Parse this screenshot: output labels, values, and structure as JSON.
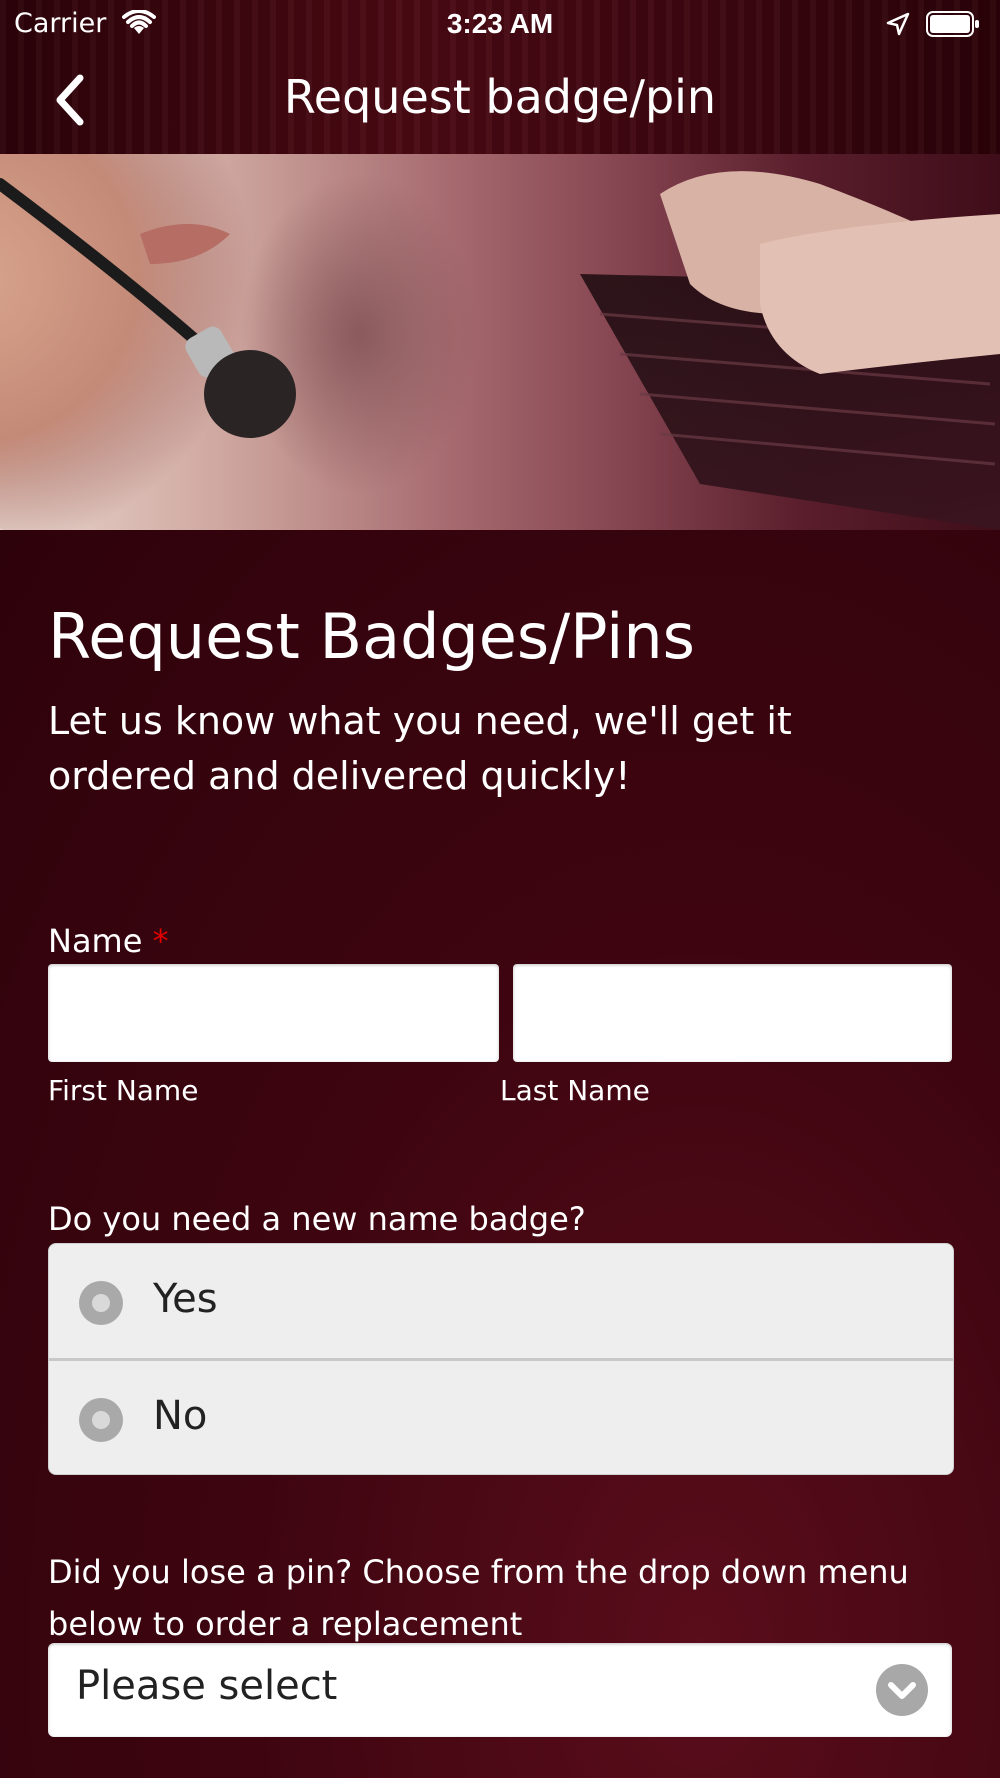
{
  "status_bar": {
    "carrier": "Carrier",
    "time": "3:23 AM",
    "icons": [
      "wifi-icon",
      "location-arrow-icon",
      "battery-icon"
    ]
  },
  "nav": {
    "back_icon": "chevron-left-icon",
    "title": "Request badge/pin"
  },
  "hero": {
    "image": "call-center-headset-and-keyboard-photo"
  },
  "content": {
    "heading": "Request Badges/Pins",
    "intro": "Let us know what you need, we'll get it ordered and delivered quickly!"
  },
  "form": {
    "name": {
      "label": "Name",
      "required_marker": "*",
      "first_name": {
        "value": "",
        "sublabel": "First Name"
      },
      "last_name": {
        "value": "",
        "sublabel": "Last Name"
      }
    },
    "badge_question": {
      "label": "Do you need a new name badge?",
      "options": [
        {
          "label": "Yes",
          "selected": false
        },
        {
          "label": "No",
          "selected": false
        }
      ]
    },
    "pin_question": {
      "label": "Did you lose a pin? Choose from the drop down menu below to order a replacement",
      "selected": "Please select"
    }
  },
  "colors": {
    "background": "#3a0510",
    "header": "#4a0913",
    "text": "#ffffff",
    "required": "#e00000",
    "input_bg": "#ffffff",
    "radio_group_bg": "#eeeeee"
  }
}
